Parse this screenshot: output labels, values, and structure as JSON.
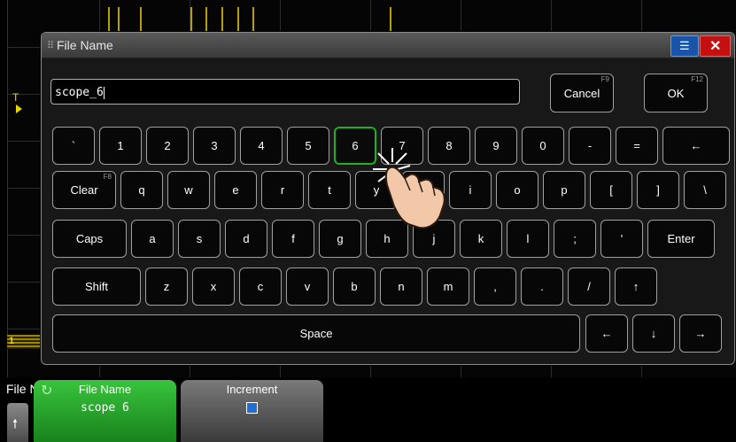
{
  "dialog": {
    "title": "File Name",
    "menu_icon": "list-icon",
    "close_icon": "close-icon",
    "filename_value": "scope_6",
    "cancel": {
      "label": "Cancel",
      "fkey": "F9"
    },
    "ok": {
      "label": "OK",
      "fkey": "F12"
    }
  },
  "keyboard": {
    "row1": [
      "`",
      "1",
      "2",
      "3",
      "4",
      "5",
      "6",
      "7",
      "8",
      "9",
      "0",
      "-",
      "=",
      "←"
    ],
    "row2": [
      "Clear",
      "q",
      "w",
      "e",
      "r",
      "t",
      "y",
      "u",
      "i",
      "o",
      "p",
      "[",
      "]",
      "\\"
    ],
    "clear_fkey": "F8",
    "row3": [
      "Caps",
      "a",
      "s",
      "d",
      "f",
      "g",
      "h",
      "j",
      "k",
      "l",
      ";",
      "'",
      "Enter"
    ],
    "row4": [
      "Shift",
      "z",
      "x",
      "c",
      "v",
      "b",
      "n",
      "m",
      ",",
      ".",
      "/",
      "↑"
    ],
    "row5": [
      "Space",
      "←",
      "↓",
      "→"
    ],
    "pressed_key": "6"
  },
  "softkeys": {
    "menu_title": "File Name Menu",
    "back_icon": "up-arrow-icon",
    "filename": {
      "label": "File Name",
      "value": "scope 6",
      "icon": "refresh-icon"
    },
    "increment": {
      "label": "Increment",
      "checked": true
    }
  },
  "colors": {
    "pressed_border": "#20b020",
    "softkey_active": "#2aa82e",
    "close_red": "#c41010",
    "menu_blue": "#1a54a8",
    "trace_yellow": "#e9d400"
  }
}
